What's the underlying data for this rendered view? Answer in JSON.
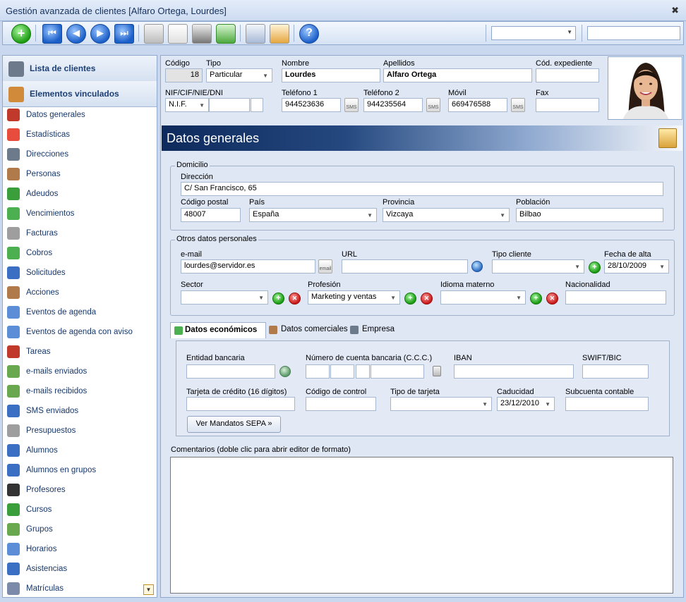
{
  "window": {
    "title": "Gestión avanzada de clientes [Alfaro Ortega, Lourdes]",
    "close_glyph": "✖"
  },
  "toolbar": {
    "icons": [
      "add-icon",
      "first-record-icon",
      "previous-record-icon",
      "next-record-icon",
      "last-record-icon",
      "search-icon",
      "copy-icon",
      "print-icon",
      "refresh-icon",
      "settings-icon",
      "calendar-icon",
      "help-icon"
    ],
    "help_glyph": "?",
    "combo_value": "",
    "search_value": ""
  },
  "sidebar": {
    "headers": [
      {
        "label": "Lista de clientes",
        "icon": "client-list-icon"
      },
      {
        "label": "Elementos vinculados",
        "icon": "linked-elements-icon"
      }
    ],
    "items": [
      {
        "label": "Datos generales",
        "icon": "general-data-icon",
        "color": "#c0392b"
      },
      {
        "label": "Estadísticas",
        "icon": "statistics-icon",
        "color": "#e74c3c"
      },
      {
        "label": "Direcciones",
        "icon": "addresses-icon",
        "color": "#6d7a8c"
      },
      {
        "label": "Personas",
        "icon": "people-icon",
        "color": "#b07a4a"
      },
      {
        "label": "Adeudos",
        "icon": "debts-icon",
        "color": "#3a9e3a"
      },
      {
        "label": "Vencimientos",
        "icon": "due-dates-icon",
        "color": "#4caf50"
      },
      {
        "label": "Facturas",
        "icon": "invoices-icon",
        "color": "#9e9e9e"
      },
      {
        "label": "Cobros",
        "icon": "payments-icon",
        "color": "#4caf50"
      },
      {
        "label": "Solicitudes",
        "icon": "requests-icon",
        "color": "#3a6fc4"
      },
      {
        "label": "Acciones",
        "icon": "actions-icon",
        "color": "#b07a4a"
      },
      {
        "label": "Eventos de agenda",
        "icon": "agenda-events-icon",
        "color": "#5b8ed6"
      },
      {
        "label": "Eventos de agenda con aviso",
        "icon": "agenda-alerts-icon",
        "color": "#5b8ed6"
      },
      {
        "label": "Tareas",
        "icon": "tasks-icon",
        "color": "#c0392b"
      },
      {
        "label": "e-mails enviados",
        "icon": "sent-emails-icon",
        "color": "#6aa84f"
      },
      {
        "label": "e-mails recibidos",
        "icon": "received-emails-icon",
        "color": "#6aa84f"
      },
      {
        "label": "SMS enviados",
        "icon": "sent-sms-icon",
        "color": "#3a6fc4"
      },
      {
        "label": "Presupuestos",
        "icon": "budgets-icon",
        "color": "#9e9e9e"
      },
      {
        "label": "Alumnos",
        "icon": "students-icon",
        "color": "#3a6fc4"
      },
      {
        "label": "Alumnos en grupos",
        "icon": "students-groups-icon",
        "color": "#3a6fc4"
      },
      {
        "label": "Profesores",
        "icon": "teachers-icon",
        "color": "#333333"
      },
      {
        "label": "Cursos",
        "icon": "courses-icon",
        "color": "#3a9e3a"
      },
      {
        "label": "Grupos",
        "icon": "groups-icon",
        "color": "#6aa84f"
      },
      {
        "label": "Horarios",
        "icon": "schedules-icon",
        "color": "#5b8ed6"
      },
      {
        "label": "Asistencias",
        "icon": "attendance-icon",
        "color": "#3a6fc4"
      },
      {
        "label": "Matrículas",
        "icon": "enrollments-icon",
        "color": "#7a8aa8"
      }
    ],
    "scroll_glyph": "▼"
  },
  "header_form": {
    "codigo_label": "Código",
    "codigo_value": "18",
    "tipo_label": "Tipo",
    "tipo_value": "Particular",
    "nombre_label": "Nombre",
    "nombre_value": "Lourdes",
    "apellidos_label": "Apellidos",
    "apellidos_value": "Alfaro Ortega",
    "expediente_label": "Cód. expediente",
    "expediente_value": "",
    "nif_label": "NIF/CIF/NIE/DNI",
    "nif_type_value": "N.I.F.",
    "nif_value": "",
    "nif_letter": "",
    "tel1_label": "Teléfono 1",
    "tel1_value": "944523636",
    "tel2_label": "Teléfono 2",
    "tel2_value": "944235564",
    "movil_label": "Móvil",
    "movil_value": "669476588",
    "fax_label": "Fax",
    "fax_value": "",
    "sms_label": "SMS"
  },
  "section": {
    "title": "Datos generales"
  },
  "domicilio": {
    "group_title": "Domicilio",
    "direccion_label": "Dirección",
    "direccion_value": "C/ San Francisco, 65",
    "cp_label": "Código postal",
    "cp_value": "48007",
    "pais_label": "País",
    "pais_value": "España",
    "provincia_label": "Provincia",
    "provincia_value": "Vizcaya",
    "poblacion_label": "Población",
    "poblacion_value": "Bilbao"
  },
  "otros": {
    "group_title": "Otros datos personales",
    "email_label": "e-mail",
    "email_value": "lourdes@servidor.es",
    "email_icon_label": "email",
    "url_label": "URL",
    "url_value": "",
    "tipo_cliente_label": "Tipo cliente",
    "tipo_cliente_value": "",
    "fecha_alta_label": "Fecha de alta",
    "fecha_alta_value": "28/10/2009",
    "sector_label": "Sector",
    "sector_value": "",
    "profesion_label": "Profesión",
    "profesion_value": "Marketing y ventas",
    "idioma_label": "Idioma materno",
    "idioma_value": "",
    "nacionalidad_label": "Nacionalidad",
    "nacionalidad_value": ""
  },
  "tabs": [
    {
      "label": "Datos económicos",
      "icon": "money-icon"
    },
    {
      "label": "Datos comerciales",
      "icon": "commercial-icon"
    },
    {
      "label": "Empresa",
      "icon": "company-icon"
    }
  ],
  "economicos": {
    "entidad_label": "Entidad bancaria",
    "entidad_value": "",
    "ccc_label": "Número de cuenta bancaria (C.C.C.)",
    "iban_label": "IBAN",
    "iban_value": "",
    "swift_label": "SWIFT/BIC",
    "swift_value": "",
    "tarjeta_label": "Tarjeta de crédito (16 dígitos)",
    "tarjeta_value": "",
    "control_label": "Código de control",
    "control_value": "",
    "tipo_tarjeta_label": "Tipo de tarjeta",
    "tipo_tarjeta_value": "",
    "caducidad_label": "Caducidad",
    "caducidad_value": "23/12/2010",
    "subcuenta_label": "Subcuenta contable",
    "subcuenta_value": "",
    "sepa_button": "Ver Mandatos SEPA »"
  },
  "comments": {
    "label": "Comentarios (doble clic para abrir editor de formato)",
    "value": ""
  },
  "glyphs": {
    "add": "+",
    "remove": "✕",
    "dropdown": "▼",
    "prev": "◀",
    "next": "▶"
  }
}
